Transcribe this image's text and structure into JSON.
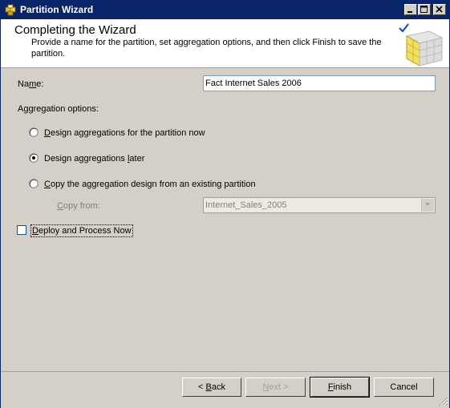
{
  "window": {
    "title": "Partition Wizard",
    "icon": "partition-wizard-icon",
    "controls": [
      "minimize-icon",
      "maximize-icon",
      "close-icon"
    ]
  },
  "header": {
    "title": "Completing the Wizard",
    "description": "Provide a name for the partition, set aggregation options, and then click Finish to save the partition.",
    "image": "olap-cube-checkmark-icon"
  },
  "name_field": {
    "label_prefix": "Na",
    "label_underlined": "m",
    "label_suffix": "e:",
    "value": "Fact Internet Sales 2006"
  },
  "aggregation": {
    "heading": "Aggregation options:",
    "options": [
      {
        "label_prefix": "",
        "label_underlined": "D",
        "label_suffix": "esign aggregations for the partition now",
        "selected": false
      },
      {
        "label_prefix": "Design aggregations ",
        "label_underlined": "l",
        "label_suffix": "ater",
        "selected": true
      },
      {
        "label_prefix": "",
        "label_underlined": "C",
        "label_suffix": "opy the aggregation design from an existing partition",
        "selected": false
      }
    ],
    "copy_from": {
      "label_prefix": "",
      "label_underlined": "C",
      "label_suffix": "opy from:",
      "value": "Internet_Sales_2005",
      "enabled": false
    }
  },
  "deploy": {
    "label_prefix": "",
    "label_underlined": "D",
    "label_suffix": "eploy and Process Now",
    "checked": false
  },
  "buttons": {
    "back": {
      "label_prefix": "< ",
      "label_underlined": "B",
      "label_suffix": "ack",
      "enabled": true
    },
    "next": {
      "label_prefix": "",
      "label_underlined": "N",
      "label_suffix": "ext >",
      "enabled": false
    },
    "finish": {
      "label_prefix": "",
      "label_underlined": "F",
      "label_suffix": "inish",
      "enabled": true
    },
    "cancel": {
      "label_prefix": "",
      "label_underlined": "",
      "label_suffix": "Cancel",
      "enabled": true
    }
  },
  "colors": {
    "titlebar": "#0a246a",
    "dialog_bg": "#d4d0c8",
    "header_bg": "#ffffff",
    "disabled_text": "#808080"
  }
}
